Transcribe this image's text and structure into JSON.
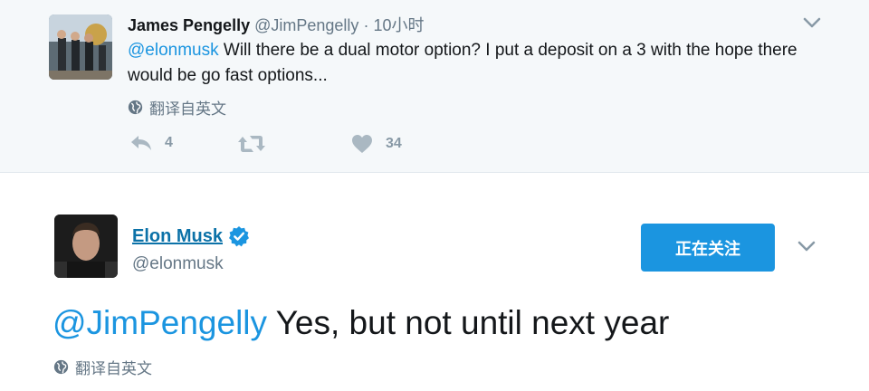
{
  "reply_tweet": {
    "display_name": "James Pengelly",
    "handle": "@JimPengelly",
    "separator": "·",
    "time": "10小时",
    "mention": "@elonmusk",
    "text": " Will there be a dual motor option? I put a deposit on a 3 with the hope there would be go fast options...",
    "translate_label": "翻译自英文",
    "actions": {
      "reply_count": "4",
      "retweet_count": "",
      "like_count": "34"
    }
  },
  "main_tweet": {
    "display_name": "Elon Musk",
    "handle": "@elonmusk",
    "follow_button_label": "正在关注",
    "mention": "@JimPengelly",
    "text": " Yes, but not until next year",
    "translate_label": "翻译自英文"
  },
  "icons": {
    "globe": "globe-icon",
    "reply": "reply-icon",
    "retweet": "retweet-icon",
    "like": "heart-icon",
    "verified": "verified-badge-icon",
    "more": "chevron-down-icon"
  },
  "colors": {
    "accent": "#1b95e0",
    "name_link": "#0c72a8",
    "muted": "#657786",
    "reply_background": "#f5f8fa"
  }
}
